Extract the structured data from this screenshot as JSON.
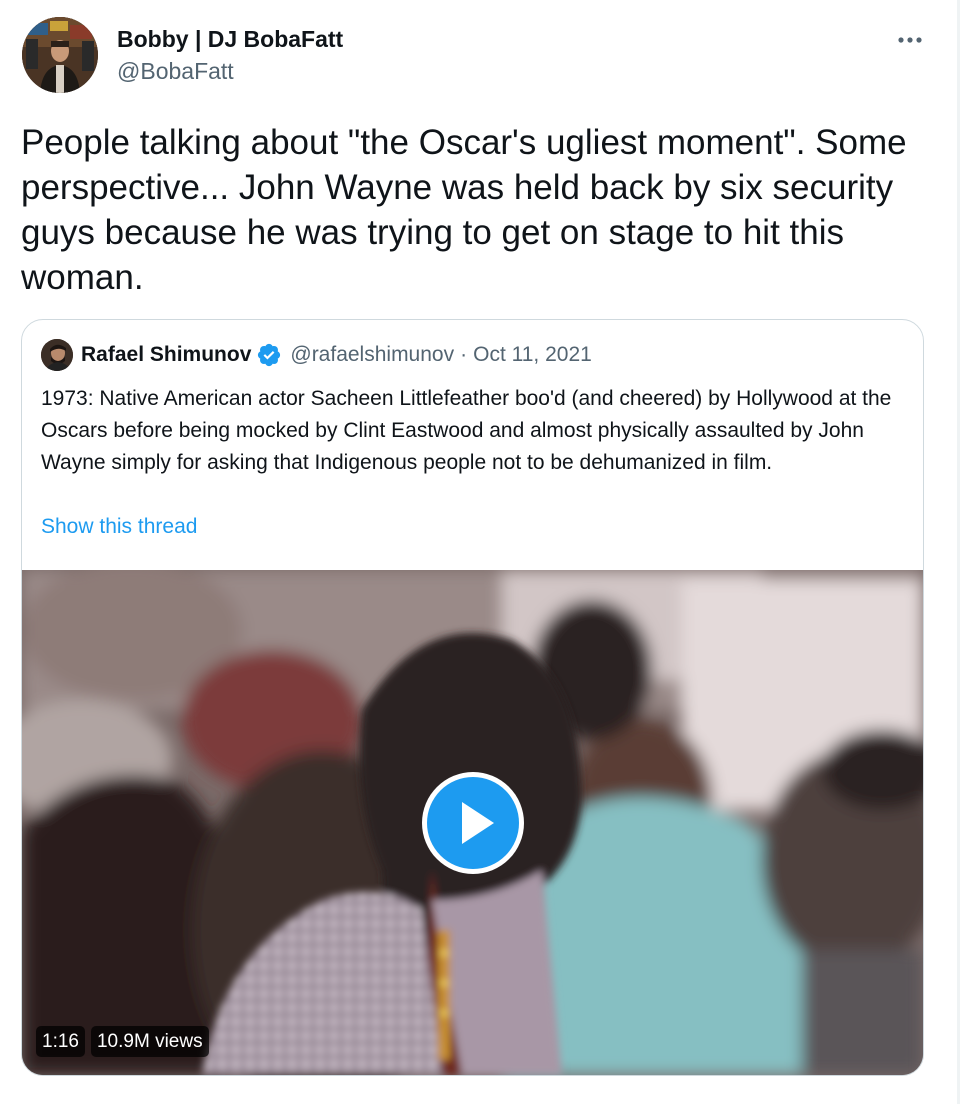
{
  "tweet": {
    "author_name": "Bobby | DJ BobaFatt",
    "author_handle": "@BobaFatt",
    "more_icon": "more-horizontal-icon",
    "text": "People talking about \"the Oscar's ugliest moment\". Some perspective... John Wayne was held back by six security guys because he was trying to get on stage to hit this woman."
  },
  "quote": {
    "author_name": "Rafael Shimunov",
    "verified_icon": "verified-badge-icon",
    "author_handle": "@rafaelshimunov",
    "separator": "·",
    "date": "Oct 11, 2021",
    "text": "1973: Native American actor Sacheen Littlefeather boo'd (and cheered) by Hollywood at the Oscars before being mocked by Clint Eastwood and almost physically assaulted by John Wayne simply for asking that Indigenous people not to be dehumanized in film.",
    "show_thread_label": "Show this thread",
    "video": {
      "play_icon": "play-icon",
      "duration": "1:16",
      "views": "10.9M views"
    }
  },
  "colors": {
    "text_primary": "#0f1419",
    "text_secondary": "#536471",
    "link": "#1d9bf0",
    "border": "#cfd9de"
  }
}
